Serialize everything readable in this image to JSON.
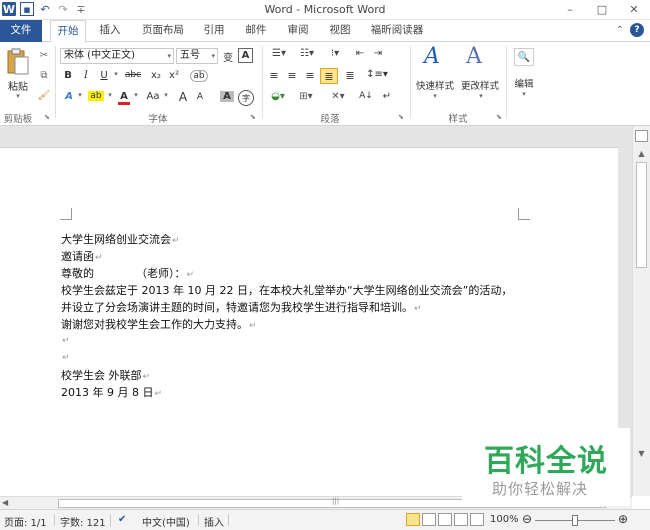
{
  "window": {
    "title": "Word - Microsoft Word",
    "minimize": "–",
    "maximize": "□",
    "close": "✕"
  },
  "qat": {
    "logo": "W",
    "save": "▪",
    "undo": "↶",
    "redo": "↷",
    "customize": "∓"
  },
  "tabs": {
    "file": "文件",
    "home": "开始",
    "insert": "插入",
    "layout": "页面布局",
    "references": "引用",
    "mailings": "邮件",
    "review": "审阅",
    "view": "视图",
    "reader": "福昕阅读器",
    "collapse": "⌃",
    "help": "?"
  },
  "ribbon": {
    "clipboard": {
      "paste": "粘贴",
      "label": "剪贴板"
    },
    "font": {
      "font_name": "宋体 (中文正文)",
      "font_size": "五号",
      "wen": "变",
      "A_box": "A",
      "bold": "B",
      "italic": "I",
      "underline": "U",
      "strike": "abc",
      "subscript": "x₂",
      "superscript": "x²",
      "clear": "ab",
      "effect": "A",
      "highlight": "ab",
      "color": "A",
      "aa": "Aa",
      "grow": "A",
      "shrink": "A",
      "shade": "A",
      "enclose": "字",
      "label": "字体"
    },
    "paragraph": {
      "label": "段落",
      "sort": "A↓",
      "marks": "↵"
    },
    "styles": {
      "quick": "快速样式",
      "change": "更改样式",
      "label": "样式"
    },
    "editing": {
      "label": "编辑"
    }
  },
  "document": {
    "lines": [
      "大学生网络创业交流会",
      "邀请函",
      "尊敬的            （老师）：",
      "校学生会兹定于 2013 年 10 月 22 日，在本校大礼堂举办“大学生网络创业交流会”的活动，",
      "并设立了分会场演讲主题的时间，特邀请您为我校学生进行指导和培训。",
      "谢谢您对我校学生会工作的大力支持。",
      "",
      "",
      "校学生会 外联部",
      "2013 年 9 月 8 日"
    ],
    "mark": "↵"
  },
  "watermark": {
    "main": "百科全说",
    "sub": "助你轻松解决"
  },
  "status": {
    "page": "页面: 1/1",
    "words": "字数: 121",
    "language": "中文(中国)",
    "mode": "插入",
    "zoom": "100%",
    "zoom_out": "⊖",
    "zoom_in": "⊕"
  },
  "colors": {
    "accent": "#2b579a",
    "watermark_green": "#2fa85a"
  }
}
